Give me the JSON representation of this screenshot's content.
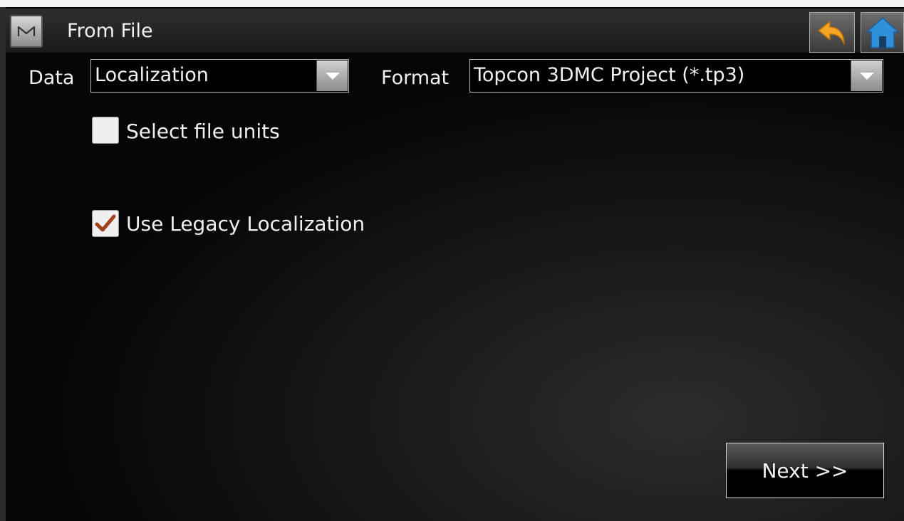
{
  "window": {
    "title": "From File",
    "menu_button_letter": "M"
  },
  "toolbar": {
    "back_icon": "undo-arrow-icon",
    "home_icon": "home-icon"
  },
  "fields": {
    "data_label": "Data",
    "data_value": "Localization",
    "format_label": "Format",
    "format_value": "Topcon 3DMC Project (*.tp3)"
  },
  "options": {
    "select_file_units": {
      "label": "Select file units",
      "checked": false
    },
    "use_legacy_localization": {
      "label": "Use Legacy Localization",
      "checked": true
    }
  },
  "actions": {
    "next_label": "Next >>"
  },
  "colors": {
    "checkmark": "#a0411f",
    "home_blue": "#2f8fd8",
    "back_arrow": "#f2a623"
  }
}
